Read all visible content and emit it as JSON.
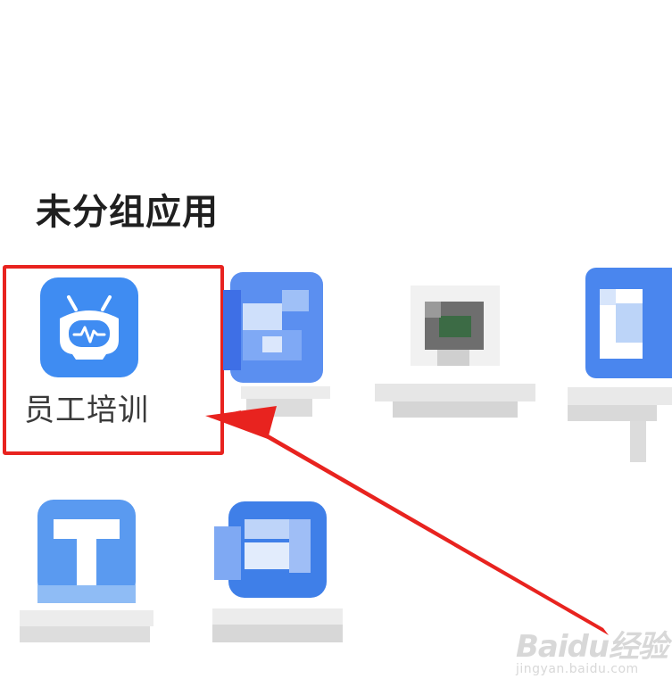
{
  "section": {
    "title": "未分组应用"
  },
  "apps": [
    {
      "label": "员工培训",
      "icon": "training-bot-icon",
      "highlighted": true
    },
    {
      "label": "",
      "icon": "pixelated-blue-app-icon",
      "blurred": true
    },
    {
      "label": "",
      "icon": "pixelated-gray-app-icon",
      "blurred": true
    },
    {
      "label": "",
      "icon": "pixelated-blue-app-icon",
      "blurred": true
    },
    {
      "label": "",
      "icon": "pixelated-t-app-icon",
      "blurred": true
    },
    {
      "label": "",
      "icon": "pixelated-blue-app-icon",
      "blurred": true
    }
  ],
  "annotation": {
    "highlight_color": "#e8231f",
    "arrow_color": "#e8231f"
  },
  "watermark": {
    "brand": "Baidu经验",
    "url": "jingyan.baidu.com"
  },
  "colors": {
    "accent": "#3f8cf2"
  }
}
